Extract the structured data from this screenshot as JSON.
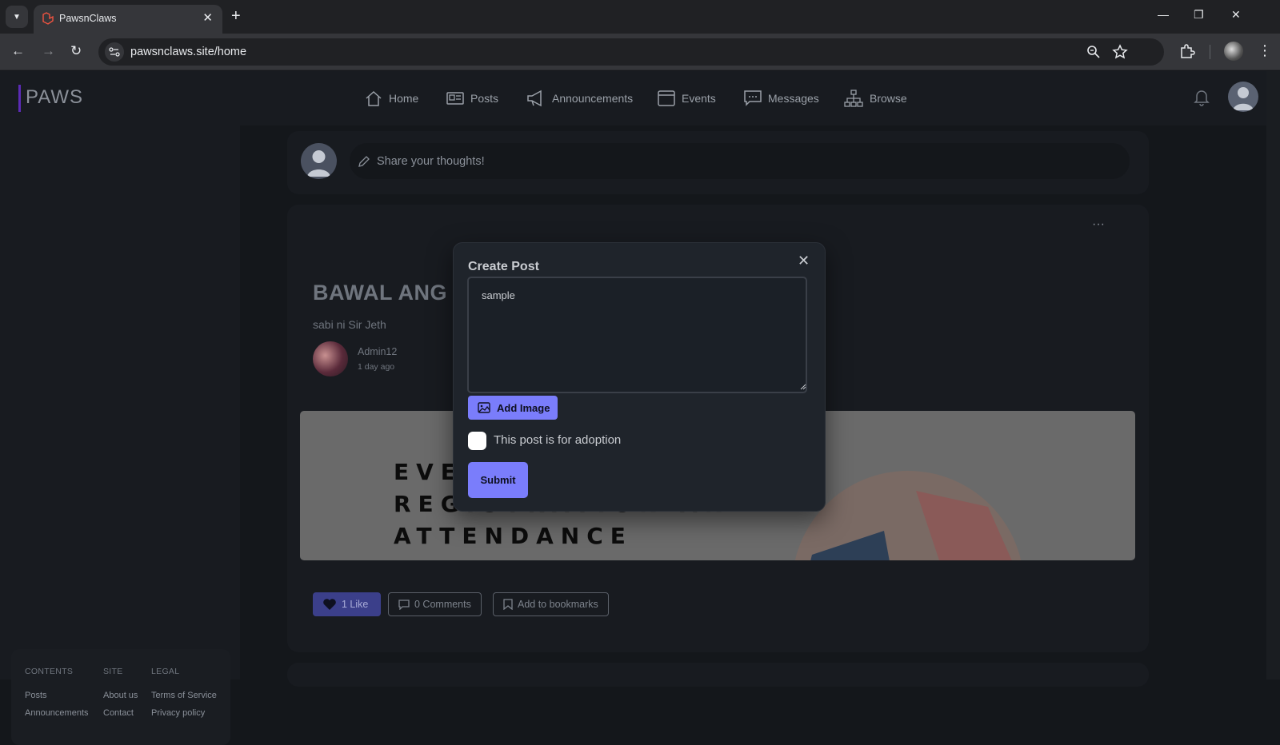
{
  "browser": {
    "tab_title": "PawsnClaws",
    "tab_close": "✕",
    "new_tab": "+",
    "url": "pawsnclaws.site/home",
    "win_minimize": "—",
    "win_restore": "❐",
    "win_close": "✕"
  },
  "app": {
    "logo": "PAWS",
    "nav": [
      {
        "label": "Home",
        "icon": "home-icon"
      },
      {
        "label": "Posts",
        "icon": "posts-icon"
      },
      {
        "label": "Announcements",
        "icon": "megaphone-icon"
      },
      {
        "label": "Events",
        "icon": "calendar-icon"
      },
      {
        "label": "Messages",
        "icon": "chat-icon"
      },
      {
        "label": "Browse",
        "icon": "sitemap-icon"
      }
    ],
    "composer_placeholder": "Share your thoughts!",
    "post": {
      "title": "BAWAL ANG",
      "subtitle": "sabi ni Sir Jeth",
      "author": "Admin12",
      "time": "1 day ago",
      "image_lines": [
        "EVE",
        "REGISTRATION AND",
        "ATTENDANCE"
      ],
      "more": "···",
      "like_label": "1 Like",
      "comments_label": "0 Comments",
      "bookmark_label": "Add to bookmarks"
    },
    "footer": {
      "contents_head": "CONTENTS",
      "site_head": "SITE",
      "legal_head": "LEGAL",
      "contents_links": [
        "Posts",
        "Announcements"
      ],
      "site_links": [
        "About us",
        "Contact"
      ],
      "legal_links": [
        "Terms of Service",
        "Privacy policy"
      ]
    }
  },
  "modal": {
    "title": "Create Post",
    "close": "✕",
    "textarea_value": "sample",
    "add_image_label": "Add Image",
    "adoption_label": "This post is for adoption",
    "adoption_checked": false,
    "submit_label": "Submit"
  },
  "colors": {
    "accent": "#7a7dfb",
    "background": "#14171b",
    "card": "#181b20",
    "logo_bar": "#5b2bb5"
  }
}
